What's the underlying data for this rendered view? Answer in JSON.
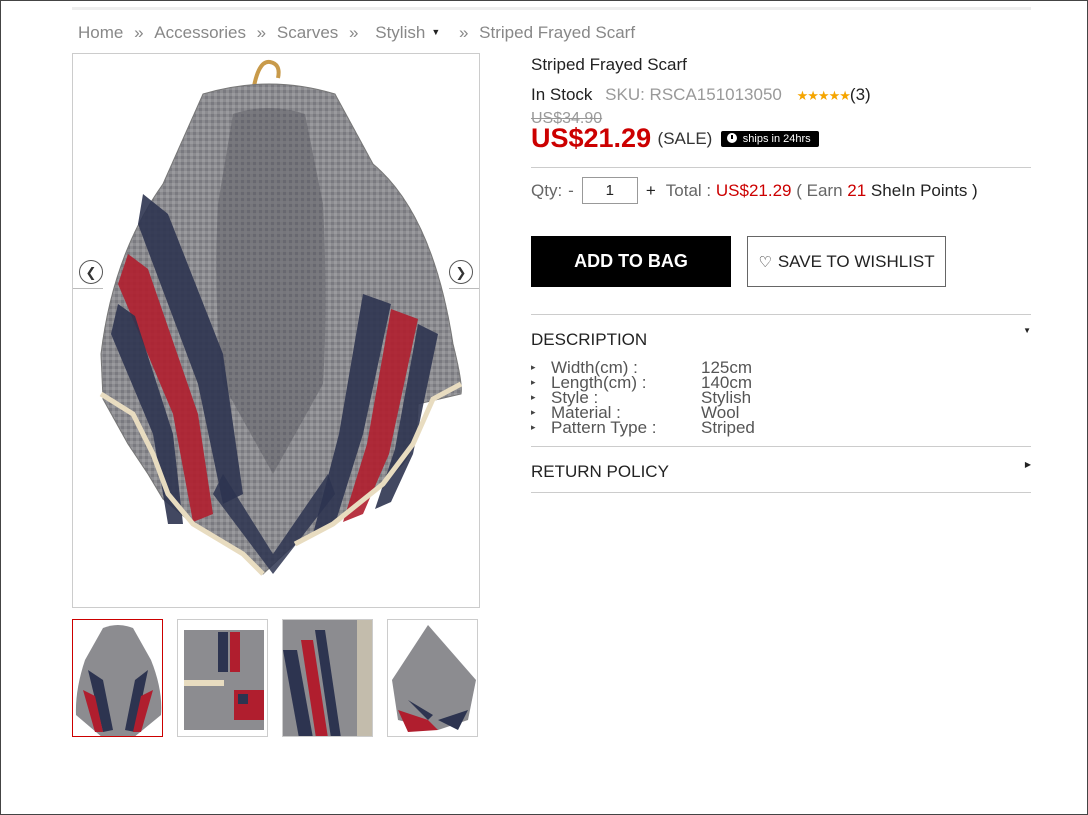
{
  "breadcrumb": {
    "home": "Home",
    "sep": "»",
    "accessories": "Accessories",
    "scarves": "Scarves",
    "stylish": "Stylish",
    "current": "Striped Frayed Scarf"
  },
  "product": {
    "title": "Striped Frayed Scarf",
    "stock": "In Stock",
    "sku": "SKU: RSCA151013050",
    "rating_stars": "★★★★★",
    "review_count": "(3)",
    "old_price": "US$34.90",
    "price": "US$21.29",
    "sale_label": "(SALE)",
    "ships_label": "ships in 24hrs"
  },
  "purchase": {
    "qty_label": "Qty:",
    "qty_minus": "-",
    "qty_value": "1",
    "qty_plus": "+",
    "total_label": "Total :",
    "total_value": "US$21.29",
    "earn_open": "( Earn",
    "earn_points": "21",
    "earn_close": "SheIn Points )",
    "add_to_bag": "ADD TO BAG",
    "save_wishlist": "SAVE TO WISHLIST"
  },
  "description": {
    "heading": "DESCRIPTION",
    "items": [
      {
        "key": "Width(cm) :",
        "value": "125cm"
      },
      {
        "key": "Length(cm) :",
        "value": "140cm"
      },
      {
        "key": "Style :",
        "value": "Stylish"
      },
      {
        "key": "Material :",
        "value": "Wool"
      },
      {
        "key": "Pattern Type :",
        "value": "Striped"
      }
    ]
  },
  "return_policy": {
    "heading": "RETURN POLICY"
  },
  "icons": {
    "prev": "chevron-left-icon",
    "next": "chevron-right-icon",
    "heart": "heart-icon",
    "clock": "clock-icon",
    "caret": "caret-down-icon"
  },
  "colors": {
    "price_red": "#cc0000",
    "button_black": "#000000",
    "scarf_gray": "#8a8a8e",
    "stripe_red": "#b01e2e",
    "stripe_navy": "#2d3450"
  }
}
